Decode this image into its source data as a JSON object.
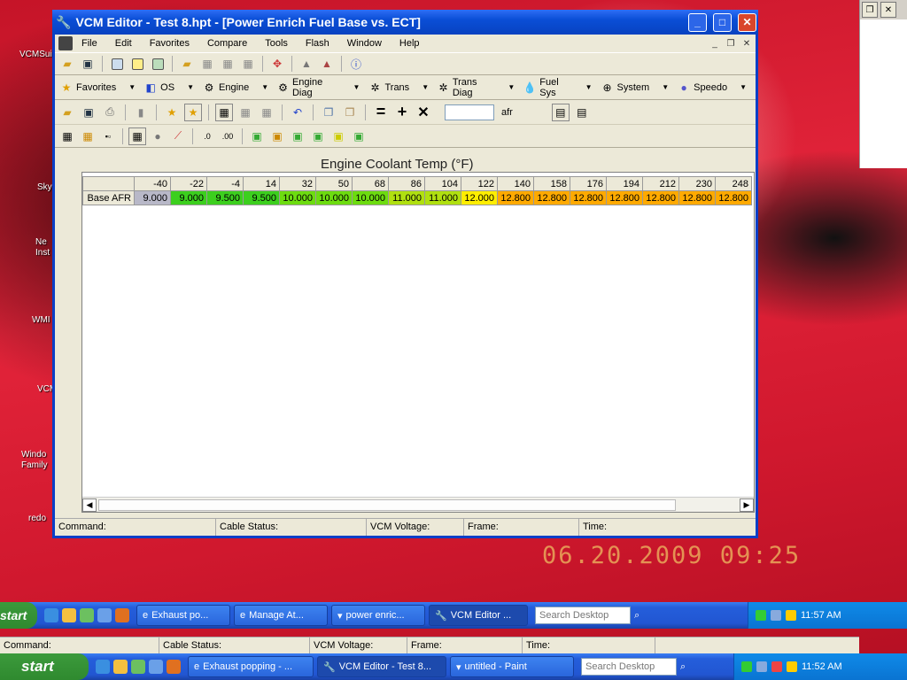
{
  "window": {
    "title": "VCM Editor - Test 8.hpt - [Power Enrich Fuel Base vs. ECT]"
  },
  "menu": [
    "File",
    "Edit",
    "Favorites",
    "Compare",
    "Tools",
    "Flash",
    "Window",
    "Help"
  ],
  "categories": [
    {
      "label": "Favorites",
      "icon": "star-icon"
    },
    {
      "label": "OS",
      "icon": "os-icon"
    },
    {
      "label": "Engine",
      "icon": "engine-icon"
    },
    {
      "label": "Engine Diag",
      "icon": "engine-diag-icon"
    },
    {
      "label": "Trans",
      "icon": "trans-gear-icon"
    },
    {
      "label": "Trans Diag",
      "icon": "trans-diag-icon"
    },
    {
      "label": "Fuel Sys",
      "icon": "fuel-drop-icon"
    },
    {
      "label": "System",
      "icon": "system-icon"
    },
    {
      "label": "Speedo",
      "icon": "speedo-icon"
    }
  ],
  "table_toolbar": {
    "unit_label": "afr",
    "value_input": ""
  },
  "table": {
    "title": "Engine Coolant Temp (°F)",
    "row_label": "Base AFR",
    "columns": [
      "-40",
      "-22",
      "-4",
      "14",
      "32",
      "50",
      "68",
      "86",
      "104",
      "122",
      "140",
      "158",
      "176",
      "194",
      "212",
      "230",
      "248"
    ],
    "values": [
      "9.000",
      "9.000",
      "9.500",
      "9.500",
      "10.000",
      "10.000",
      "10.000",
      "11.000",
      "11.000",
      "12.000",
      "12.800",
      "12.800",
      "12.800",
      "12.800",
      "12.800",
      "12.800",
      "12.800"
    ],
    "colors": [
      "#b8b8c8",
      "#3ccf1e",
      "#3ccf1e",
      "#3ccf1e",
      "#6ddc10",
      "#6ddc10",
      "#6ddc10",
      "#b0e010",
      "#b0e010",
      "#ffee00",
      "#ffaa00",
      "#ffaa00",
      "#ffaa00",
      "#ffaa00",
      "#ffaa00",
      "#ffaa00",
      "#ffaa00"
    ]
  },
  "statusbar": {
    "command": "Command:",
    "cable": "Cable Status:",
    "voltage": "VCM Voltage:",
    "frame": "Frame:",
    "time": "Time:"
  },
  "photo_stamp": "06.20.2009  09:25",
  "desktop_icons": [
    "VCMSui",
    "Sky",
    "Ne\nInst",
    "WMI",
    "VCM",
    "Windo\nFamily",
    "redo"
  ],
  "taskbar_inner": {
    "start": "start",
    "tasks": [
      "Exhaust po...",
      "Manage At...",
      "power enric...",
      "VCM Editor ..."
    ],
    "search": "Search Desktop",
    "clock": "11:57 AM"
  },
  "taskbar_outer": {
    "start": "start",
    "tasks": [
      "Exhaust popping - ...",
      "VCM Editor - Test 8...",
      "untitled - Paint"
    ],
    "search": "Search Desktop",
    "clock": "11:52 AM"
  }
}
